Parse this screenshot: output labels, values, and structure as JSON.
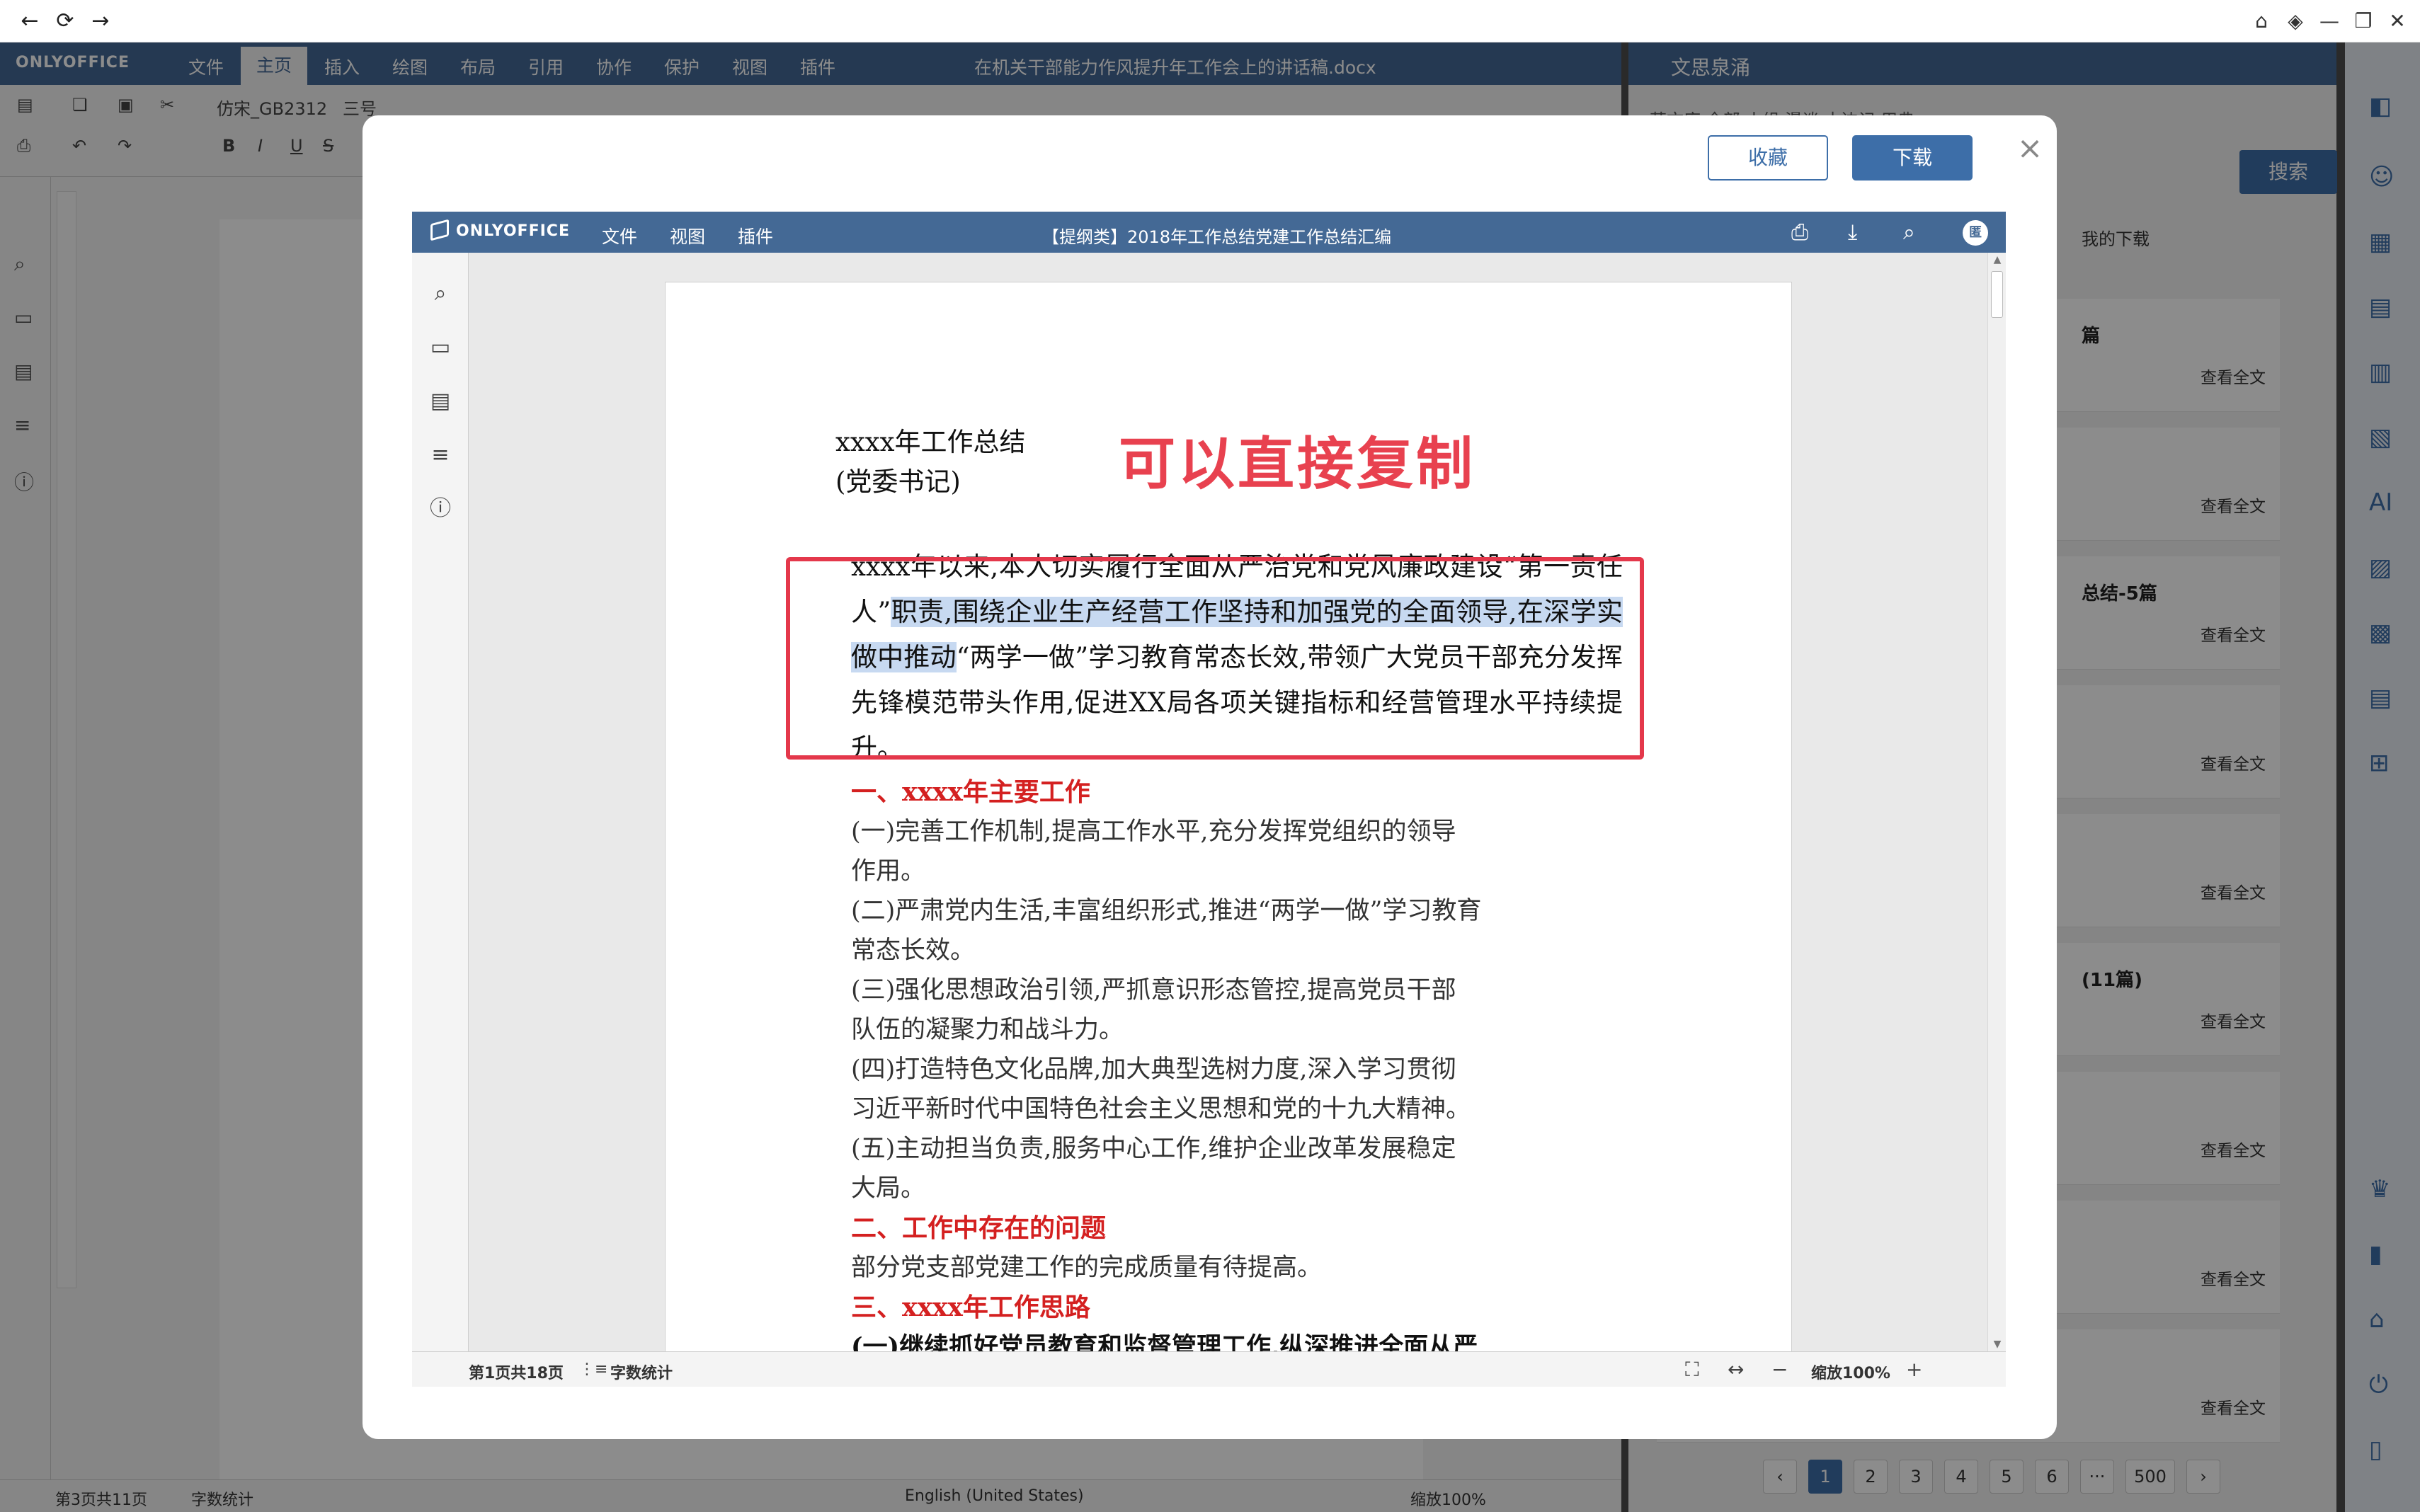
{
  "titlebar": {
    "back": "←",
    "reload": "⟳",
    "forward": "→",
    "home": "⌂",
    "pin": "◈",
    "minimize": "—",
    "restore": "❐",
    "close": "✕"
  },
  "background_editor": {
    "logo": "ONLYOFFICE",
    "menus": [
      "文件",
      "主页",
      "插入",
      "绘图",
      "布局",
      "引用",
      "协作",
      "保护",
      "视图",
      "插件"
    ],
    "active_menu": "主页",
    "doc_title": "在机关干部能力作风提升年工作会上的讲话稿.docx",
    "font_name": "仿宋_GB2312",
    "font_size": "三号",
    "status_page": "第3页共11页",
    "status_wordcount": "字数统计",
    "status_language": "English (United States)",
    "status_zoom": "缩放100%"
  },
  "side_panel": {
    "title": "文思泉涌",
    "tabs": "范文库   全部   小组   漫谈   十边记   用典",
    "search_button": "搜索",
    "my_downloads": "我的下载",
    "row_titles": [
      "篇",
      "",
      "",
      "总结-5篇",
      "",
      "",
      "(11篇)",
      "",
      "",
      ""
    ],
    "view_full": "查看全文",
    "pages": [
      "1",
      "2",
      "3",
      "4",
      "5",
      "6",
      "···",
      "500"
    ],
    "prev": "‹",
    "next": "›"
  },
  "modal": {
    "favorite_button": "收藏",
    "download_button": "下载",
    "close": "×",
    "viewer": {
      "logo": "ONLYOFFICE",
      "menus": [
        "文件",
        "视图",
        "插件"
      ],
      "doc_title": "【提纲类】2018年工作总结党建工作总结汇编",
      "avatar": "匿",
      "page": {
        "title": "xxxx年工作总结",
        "subtitle": "(党委书记)",
        "banner": "可以直接复制",
        "para_before": "xxxx年以来,本人切实履行全面从严治党和党风廉政建设“第一责任人”",
        "para_highlight": "职责,围绕企业生产经营工作坚持和加强党的全面领导,在深学实做中推动",
        "para_after": "“两学一做”学习教育常态长效,带领广大党员干部充分发挥先锋模范带头作用,促进XX局各项关键指标和经营管理水平持续提升。",
        "lines": [
          {
            "text": "一、xxxx年主要工作",
            "style": "h"
          },
          {
            "text": "(一)完善工作机制,提高工作水平,充分发挥党组织的领导",
            "style": ""
          },
          {
            "text": "作用。",
            "style": ""
          },
          {
            "text": "(二)严肃党内生活,丰富组织形式,推进“两学一做”学习教育",
            "style": ""
          },
          {
            "text": "常态长效。",
            "style": ""
          },
          {
            "text": "(三)强化思想政治引领,严抓意识形态管控,提高党员干部",
            "style": ""
          },
          {
            "text": "队伍的凝聚力和战斗力。",
            "style": ""
          },
          {
            "text": "(四)打造特色文化品牌,加大典型选树力度,深入学习贯彻",
            "style": ""
          },
          {
            "text": "习近平新时代中国特色社会主义思想和党的十九大精神。",
            "style": ""
          },
          {
            "text": "(五)主动担当负责,服务中心工作,维护企业改革发展稳定",
            "style": ""
          },
          {
            "text": "大局。",
            "style": ""
          },
          {
            "text": "二、工作中存在的问题",
            "style": "h"
          },
          {
            "text": "部分党支部党建工作的完成质量有待提高。",
            "style": ""
          },
          {
            "text": "三、xxxx年工作思路",
            "style": "h"
          },
          {
            "text": "(一)继续抓好党员教育和监督管理工作,纵深推进全面从严",
            "style": "b"
          }
        ]
      },
      "status": {
        "page_info": "第1页共18页",
        "wordcount": "字数统计",
        "zoom": "缩放100%"
      }
    }
  }
}
